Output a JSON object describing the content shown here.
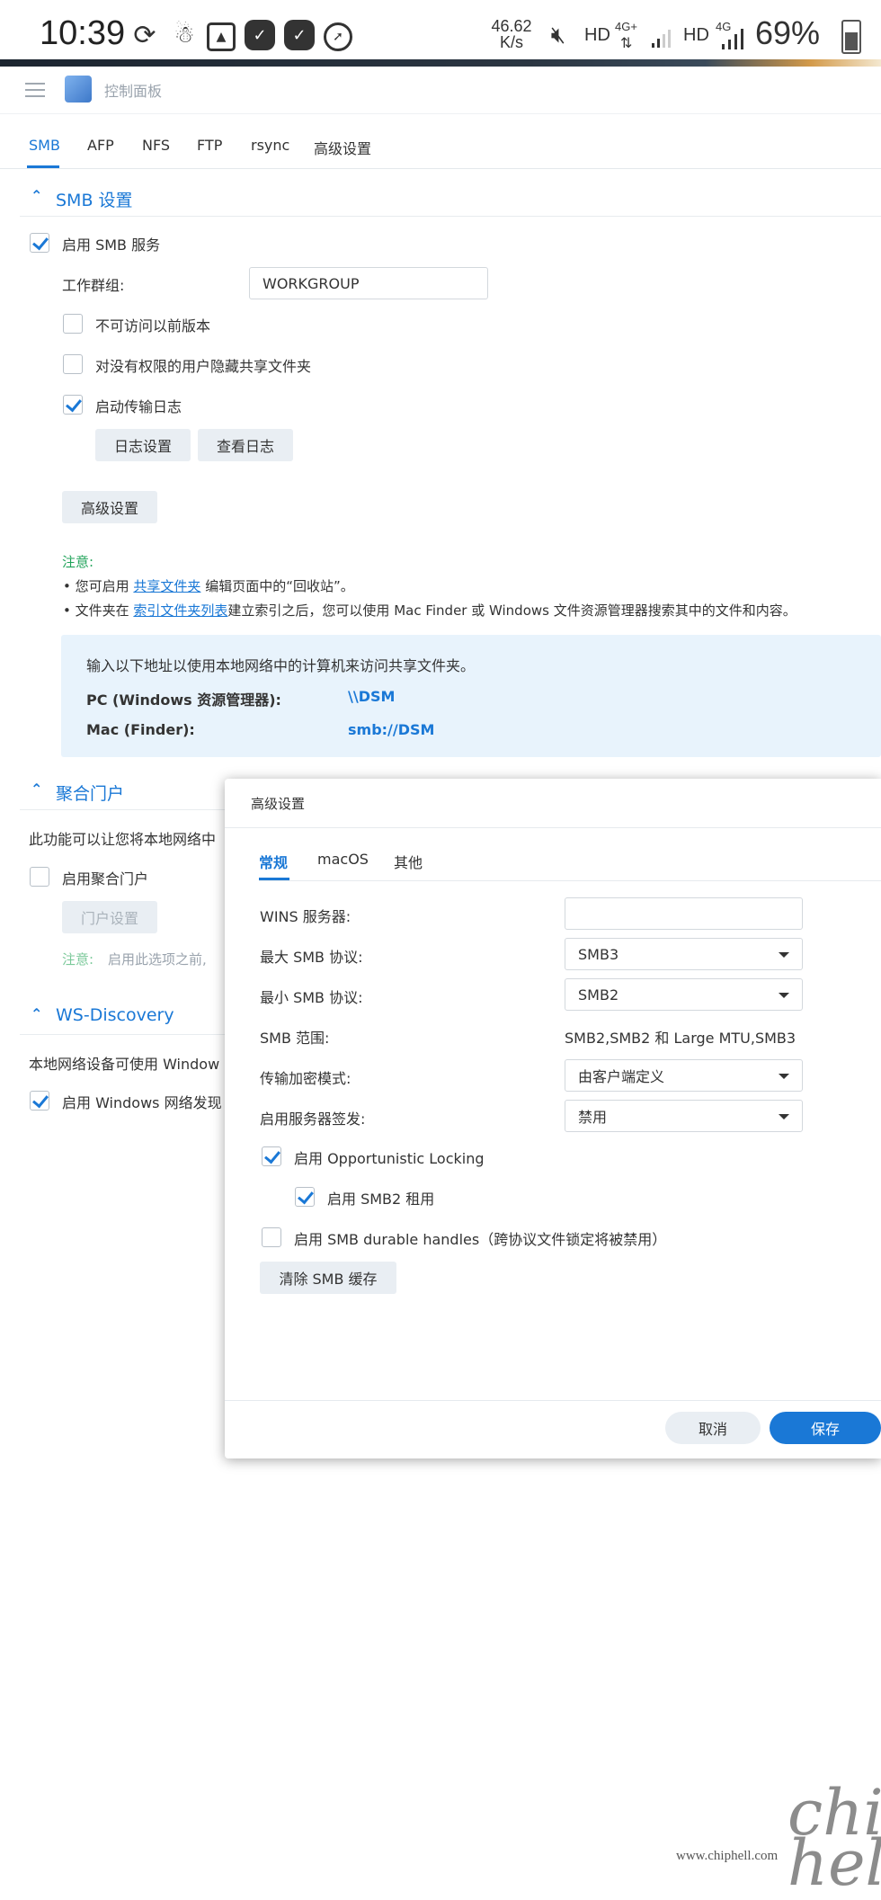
{
  "status_bar": {
    "time": "10:39",
    "net_speed_value": "46.62",
    "net_speed_unit": "K/s",
    "hd1": "HD",
    "net1": "4G+",
    "hd2": "HD",
    "net2": "4G",
    "battery": "69%"
  },
  "app": {
    "title": "控制面板"
  },
  "tabs": [
    {
      "label": "SMB"
    },
    {
      "label": "AFP"
    },
    {
      "label": "NFS"
    },
    {
      "label": "FTP"
    },
    {
      "label": "rsync"
    },
    {
      "label": "高级设置"
    }
  ],
  "smb": {
    "section_title": "SMB 设置",
    "enable_label": "启用 SMB 服务",
    "workgroup_label": "工作群组:",
    "workgroup_value": "WORKGROUP",
    "no_prev_versions": "不可访问以前版本",
    "hide_shares": "对没有权限的用户隐藏共享文件夹",
    "transfer_log": "启动传输日志",
    "log_settings_btn": "日志设置",
    "view_log_btn": "查看日志",
    "advanced_btn": "高级设置",
    "note_title": "注意:",
    "note1_prefix": "• 您可启用",
    "note1_link": "共享文件夹",
    "note1_suffix": "编辑页面中的“回收站”。",
    "note2_prefix": "• 文件夹在",
    "note2_link": "索引文件夹列表",
    "note2_suffix": "建立索引之后，您可以使用 Mac Finder 或 Windows 文件资源管理器搜索其中的文件和内容。",
    "info_text": "输入以下地址以使用本地网络中的计算机来访问共享文件夹。",
    "pc_label": "PC (Windows 资源管理器):",
    "pc_value": "\\\\DSM",
    "mac_label": "Mac (Finder):",
    "mac_value": "smb://DSM"
  },
  "portal": {
    "section_title": "聚合门户",
    "desc": "此功能可以让您将本地网络中",
    "enable_label": "启用聚合门户",
    "settings_btn": "门户设置",
    "note_title": "注意:",
    "note_text": "启用此选项之前,"
  },
  "wsd": {
    "section_title": "WS-Discovery",
    "desc": "本地网络设备可使用 Window",
    "enable_label": "启用 Windows 网络发现"
  },
  "modal": {
    "title": "高级设置",
    "tabs": [
      {
        "label": "常规"
      },
      {
        "label": "macOS"
      },
      {
        "label": "其他"
      }
    ],
    "wins_label": "WINS 服务器:",
    "wins_value": "",
    "max_smb_label": "最大 SMB 协议:",
    "max_smb_value": "SMB3",
    "min_smb_label": "最小 SMB 协议:",
    "min_smb_value": "SMB2",
    "smb_range_label": "SMB 范围:",
    "smb_range_value": "SMB2,SMB2 和 Large MTU,SMB3",
    "encrypt_label": "传输加密模式:",
    "encrypt_value": "由客户端定义",
    "signing_label": "启用服务器签发:",
    "signing_value": "禁用",
    "oplock_label": "启用 Opportunistic Locking",
    "smb2_lease_label": "启用 SMB2 租用",
    "durable_label": "启用 SMB durable handles（跨协议文件锁定将被禁用）",
    "clear_cache_btn": "清除 SMB 缓存",
    "cancel_btn": "取消",
    "save_btn": "保存"
  },
  "watermark": {
    "text": "chip hell",
    "url": "www.chiphell.com"
  },
  "colors": {
    "accent": "#1a78d6",
    "note_green": "#21a35a",
    "info_bg": "#e8f3fc"
  }
}
